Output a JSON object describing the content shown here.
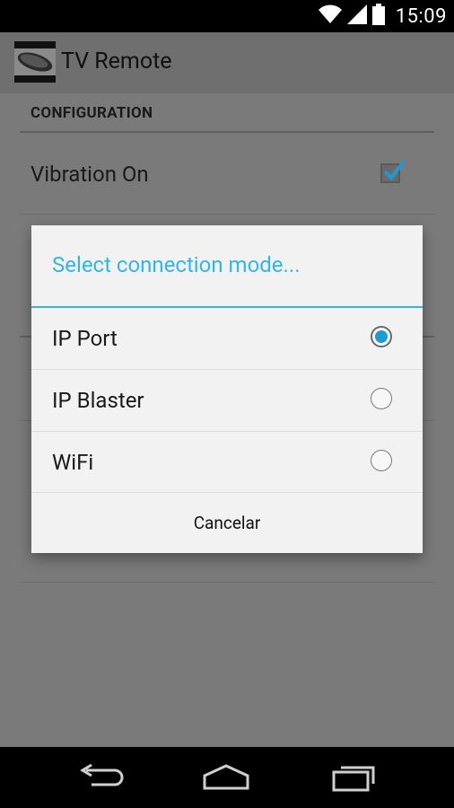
{
  "status_bar": {
    "time": "15:09",
    "icons": [
      "wifi-icon",
      "signal-icon",
      "battery-icon"
    ]
  },
  "app_bar": {
    "title": "TV Remote",
    "icon": "app-icon"
  },
  "settings": {
    "section_header": "CONFIGURATION",
    "items": [
      {
        "title": "Vibration On",
        "checked": true
      }
    ]
  },
  "dialog": {
    "title": "Select connection mode...",
    "options": [
      {
        "label": "IP Port",
        "selected": true
      },
      {
        "label": "IP Blaster",
        "selected": false
      },
      {
        "label": "WiFi",
        "selected": false
      }
    ],
    "cancel_label": "Cancelar"
  },
  "nav_bar": {
    "buttons": [
      "back-icon",
      "home-icon",
      "recents-icon"
    ]
  },
  "colors": {
    "accent": "#33b5e5",
    "radio_selected": "#1e9bd3",
    "scrim": "#7a7a7a"
  }
}
